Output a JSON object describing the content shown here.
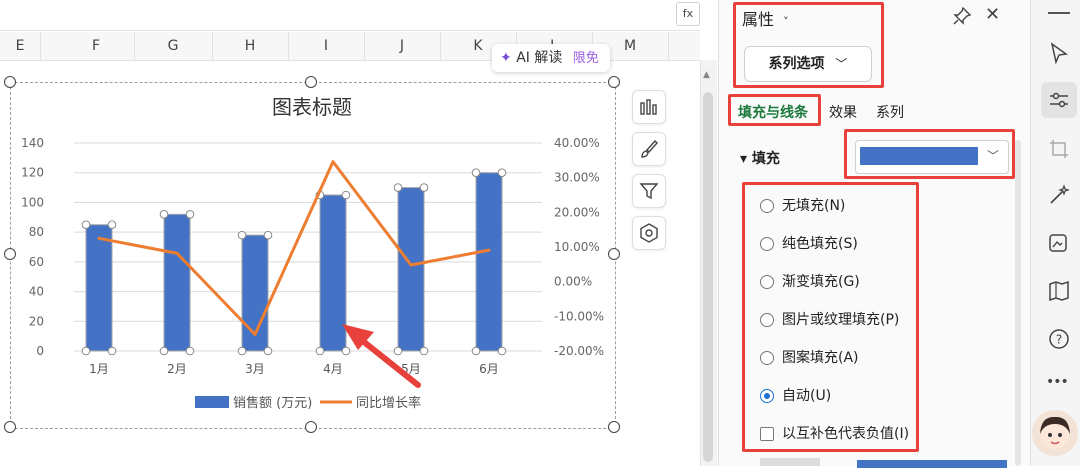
{
  "sheet": {
    "fx_label": "fx",
    "columns": [
      "E",
      "F",
      "G",
      "H",
      "I",
      "J",
      "K",
      "L",
      "M"
    ]
  },
  "ai_button": {
    "label": "AI 解读",
    "badge": "限免"
  },
  "chart_data": {
    "type": "bar",
    "title": "图表标题",
    "categories": [
      "1月",
      "2月",
      "3月",
      "4月",
      "5月",
      "6月"
    ],
    "series": [
      {
        "name": "销售额 (万元)",
        "kind": "bar",
        "axis": "left",
        "values": [
          85,
          92,
          78,
          105,
          110,
          120
        ],
        "color": "#4472c4"
      },
      {
        "name": "同比增长率",
        "kind": "line",
        "axis": "right",
        "values": [
          12.5,
          8.2,
          -15.2,
          34.6,
          4.8,
          9.1
        ],
        "color": "#ed7d31"
      }
    ],
    "ylim": [
      0,
      140
    ],
    "y_ticks": [
      "0",
      "20",
      "40",
      "60",
      "80",
      "100",
      "120",
      "140"
    ],
    "y2lim": [
      -20,
      40
    ],
    "y2_ticks": [
      "-20.00%",
      "-10.00%",
      "0.00%",
      "10.00%",
      "20.00%",
      "30.00%",
      "40.00%"
    ],
    "grid": true,
    "legend_position": "bottom"
  },
  "chart_tools": [
    "chart-elements-icon",
    "chart-style-icon",
    "chart-filter-icon",
    "chart-settings-icon"
  ],
  "panel": {
    "title": "属性",
    "title_chevron": "˅",
    "close": "✕",
    "series_dropdown": "系列选项",
    "series_chevron": "﹀",
    "tabs": [
      "填充与线条",
      "效果",
      "系列"
    ],
    "section": "▾ 填充",
    "fill_color": "#4472c4",
    "fill_chevron": "﹀",
    "options": [
      "无填充(N)",
      "纯色填充(S)",
      "渐变填充(G)",
      "图片或纹理填充(P)",
      "图案填充(A)",
      "自动(U)"
    ],
    "selected_option": "自动(U)",
    "checkbox_label": "以互补色代表负值(I)"
  },
  "toolbar": {
    "more": "•••"
  },
  "colors": {
    "accent_red": "#e8413c",
    "bar": "#4472c4",
    "line": "#ed7d31",
    "tab_active": "#1a7a3c"
  }
}
